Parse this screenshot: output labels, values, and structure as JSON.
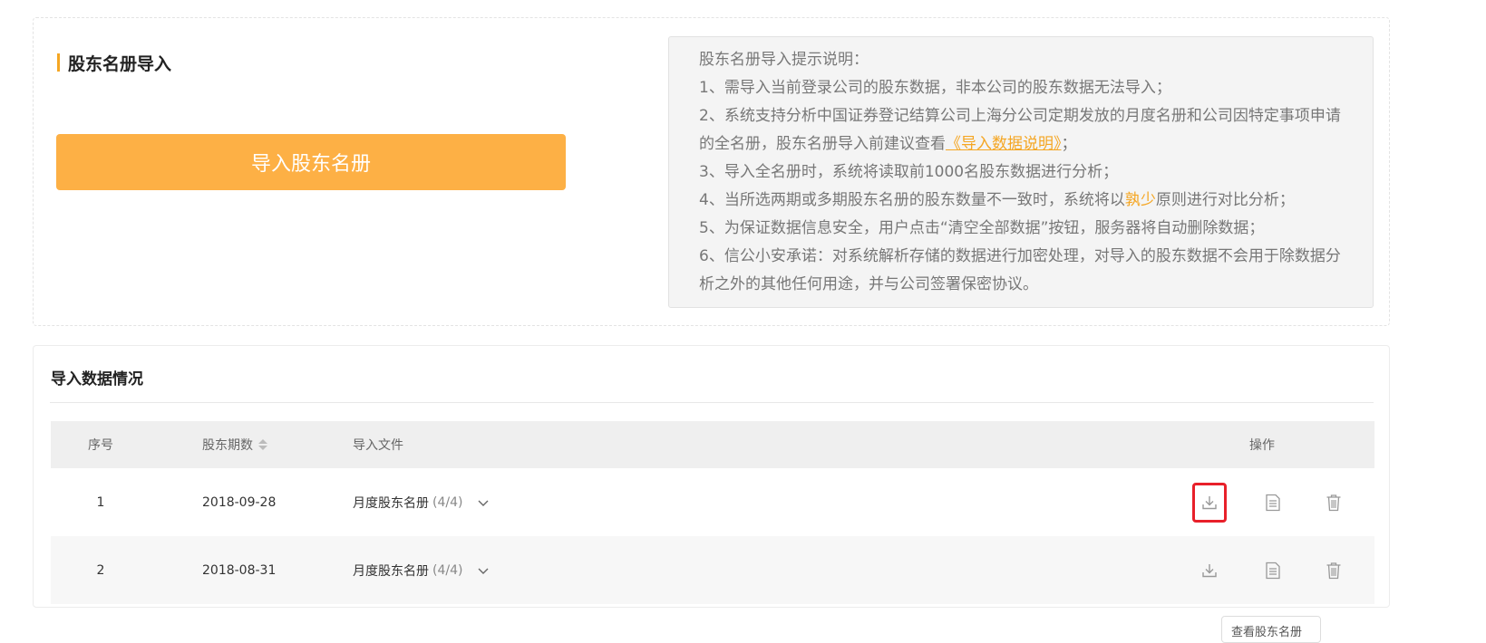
{
  "import_section": {
    "title": "股东名册导入",
    "import_button": "导入股东名册"
  },
  "notice": {
    "heading": "股东名册导入提示说明：",
    "item1": "1、需导入当前登录公司的股东数据，非本公司的股东数据无法导入；",
    "item2_part1": "2、系统支持分析中国证券登记结算公司上海分公司定期发放的月度名册和公司因特定事项申请的全名册，股东名册导入前建议查看",
    "item2_link": "《导入数据说明》",
    "item2_part2": "；",
    "item3": "3、导入全名册时，系统将读取前1000名股东数据进行分析；",
    "item4_part1": "4、当所选两期或多期股东名册的股东数量不一致时，系统将以",
    "item4_highlight": "孰少",
    "item4_part2": "原则进行对比分析；",
    "item5": "5、为保证数据信息安全，用户点击“清空全部数据”按钮，服务器将自动删除数据；",
    "item6": "6、信公小安承诺：对系统解析存储的数据进行加密处理，对导入的股东数据不会用于除数据分析之外的其他任何用途，并与公司签署保密协议。"
  },
  "data_section": {
    "title": "导入数据情况",
    "columns": {
      "index": "序号",
      "period": "股东期数",
      "file": "导入文件",
      "ops": "操作"
    },
    "rows": [
      {
        "index": "1",
        "period": "2018-09-28",
        "file_name": "月度股东名册",
        "file_count": "(4/4)"
      },
      {
        "index": "2",
        "period": "2018-08-31",
        "file_name": "月度股东名册",
        "file_count": "(4/4)"
      }
    ],
    "tooltip": "查看股东名册"
  },
  "colors": {
    "accent": "#f5a623",
    "button": "#fdb045",
    "highlight_border": "#e8202a"
  },
  "icons": [
    "download-icon",
    "document-icon",
    "trash-icon",
    "chevron-down-icon",
    "sort-icon"
  ]
}
